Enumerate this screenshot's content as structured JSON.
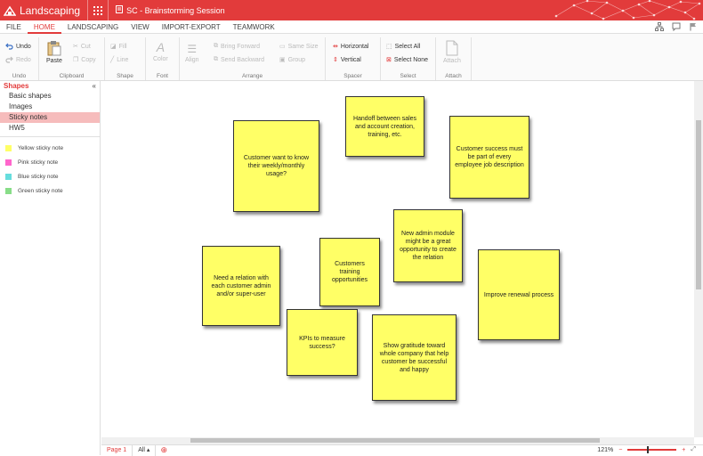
{
  "app": {
    "title": "Landscaping",
    "document_title": "SC - Brainstorming Session"
  },
  "menu": {
    "tabs": [
      "FILE",
      "HOME",
      "LANDSCAPING",
      "VIEW",
      "IMPORT-EXPORT",
      "TEAMWORK"
    ],
    "active": "HOME"
  },
  "ribbon": {
    "undo": "Undo",
    "redo": "Redo",
    "undo_group": "Undo",
    "paste": "Paste",
    "cut": "Cut",
    "copy": "Copy",
    "clipboard_group": "Clipboard",
    "fill": "Fill",
    "line": "Line",
    "shape_group": "Shape",
    "color": "Color",
    "font_group": "Font",
    "align": "Align",
    "bring_forward": "Bring Forward",
    "send_backward": "Send Backward",
    "same_size": "Same Size",
    "group": "Group",
    "arrange_group": "Arrange",
    "horizontal": "Horizontal",
    "vertical": "Vertical",
    "spacer_group": "Spacer",
    "select_all": "Select All",
    "select_none": "Select None",
    "select_group": "Select",
    "attach": "Attach",
    "attach_group": "Attach"
  },
  "left_panel": {
    "title": "Shapes",
    "categories": [
      "Basic shapes",
      "Images",
      "Sticky notes",
      "HW5"
    ],
    "selected": "Sticky notes",
    "shapes": [
      {
        "label": "Yellow sticky note",
        "color": "#ffff66"
      },
      {
        "label": "Pink sticky note",
        "color": "#ff66cc"
      },
      {
        "label": "Blue sticky note",
        "color": "#66dddd"
      },
      {
        "label": "Green sticky note",
        "color": "#88dd88"
      }
    ]
  },
  "notes": [
    "Handoff between sales and account creation, training, etc.",
    "Customer want to know their weekly/monthly usage?",
    "Customer success must be part of every employee job description",
    "New admin module might be a great opportunity to create the relation",
    "Need a relation with each customer admin and/or super-user",
    "Customers training opportunities",
    "Improve renewal process",
    "KPIs to measure success?",
    "Show gratitude toward whole company that help customer be successful and happy"
  ],
  "bottom": {
    "page_tab": "Page 1",
    "all_tab": "All",
    "zoom": "121%"
  },
  "colors": {
    "accent": "#e23b3b",
    "sticky_yellow": "#ffff66"
  }
}
